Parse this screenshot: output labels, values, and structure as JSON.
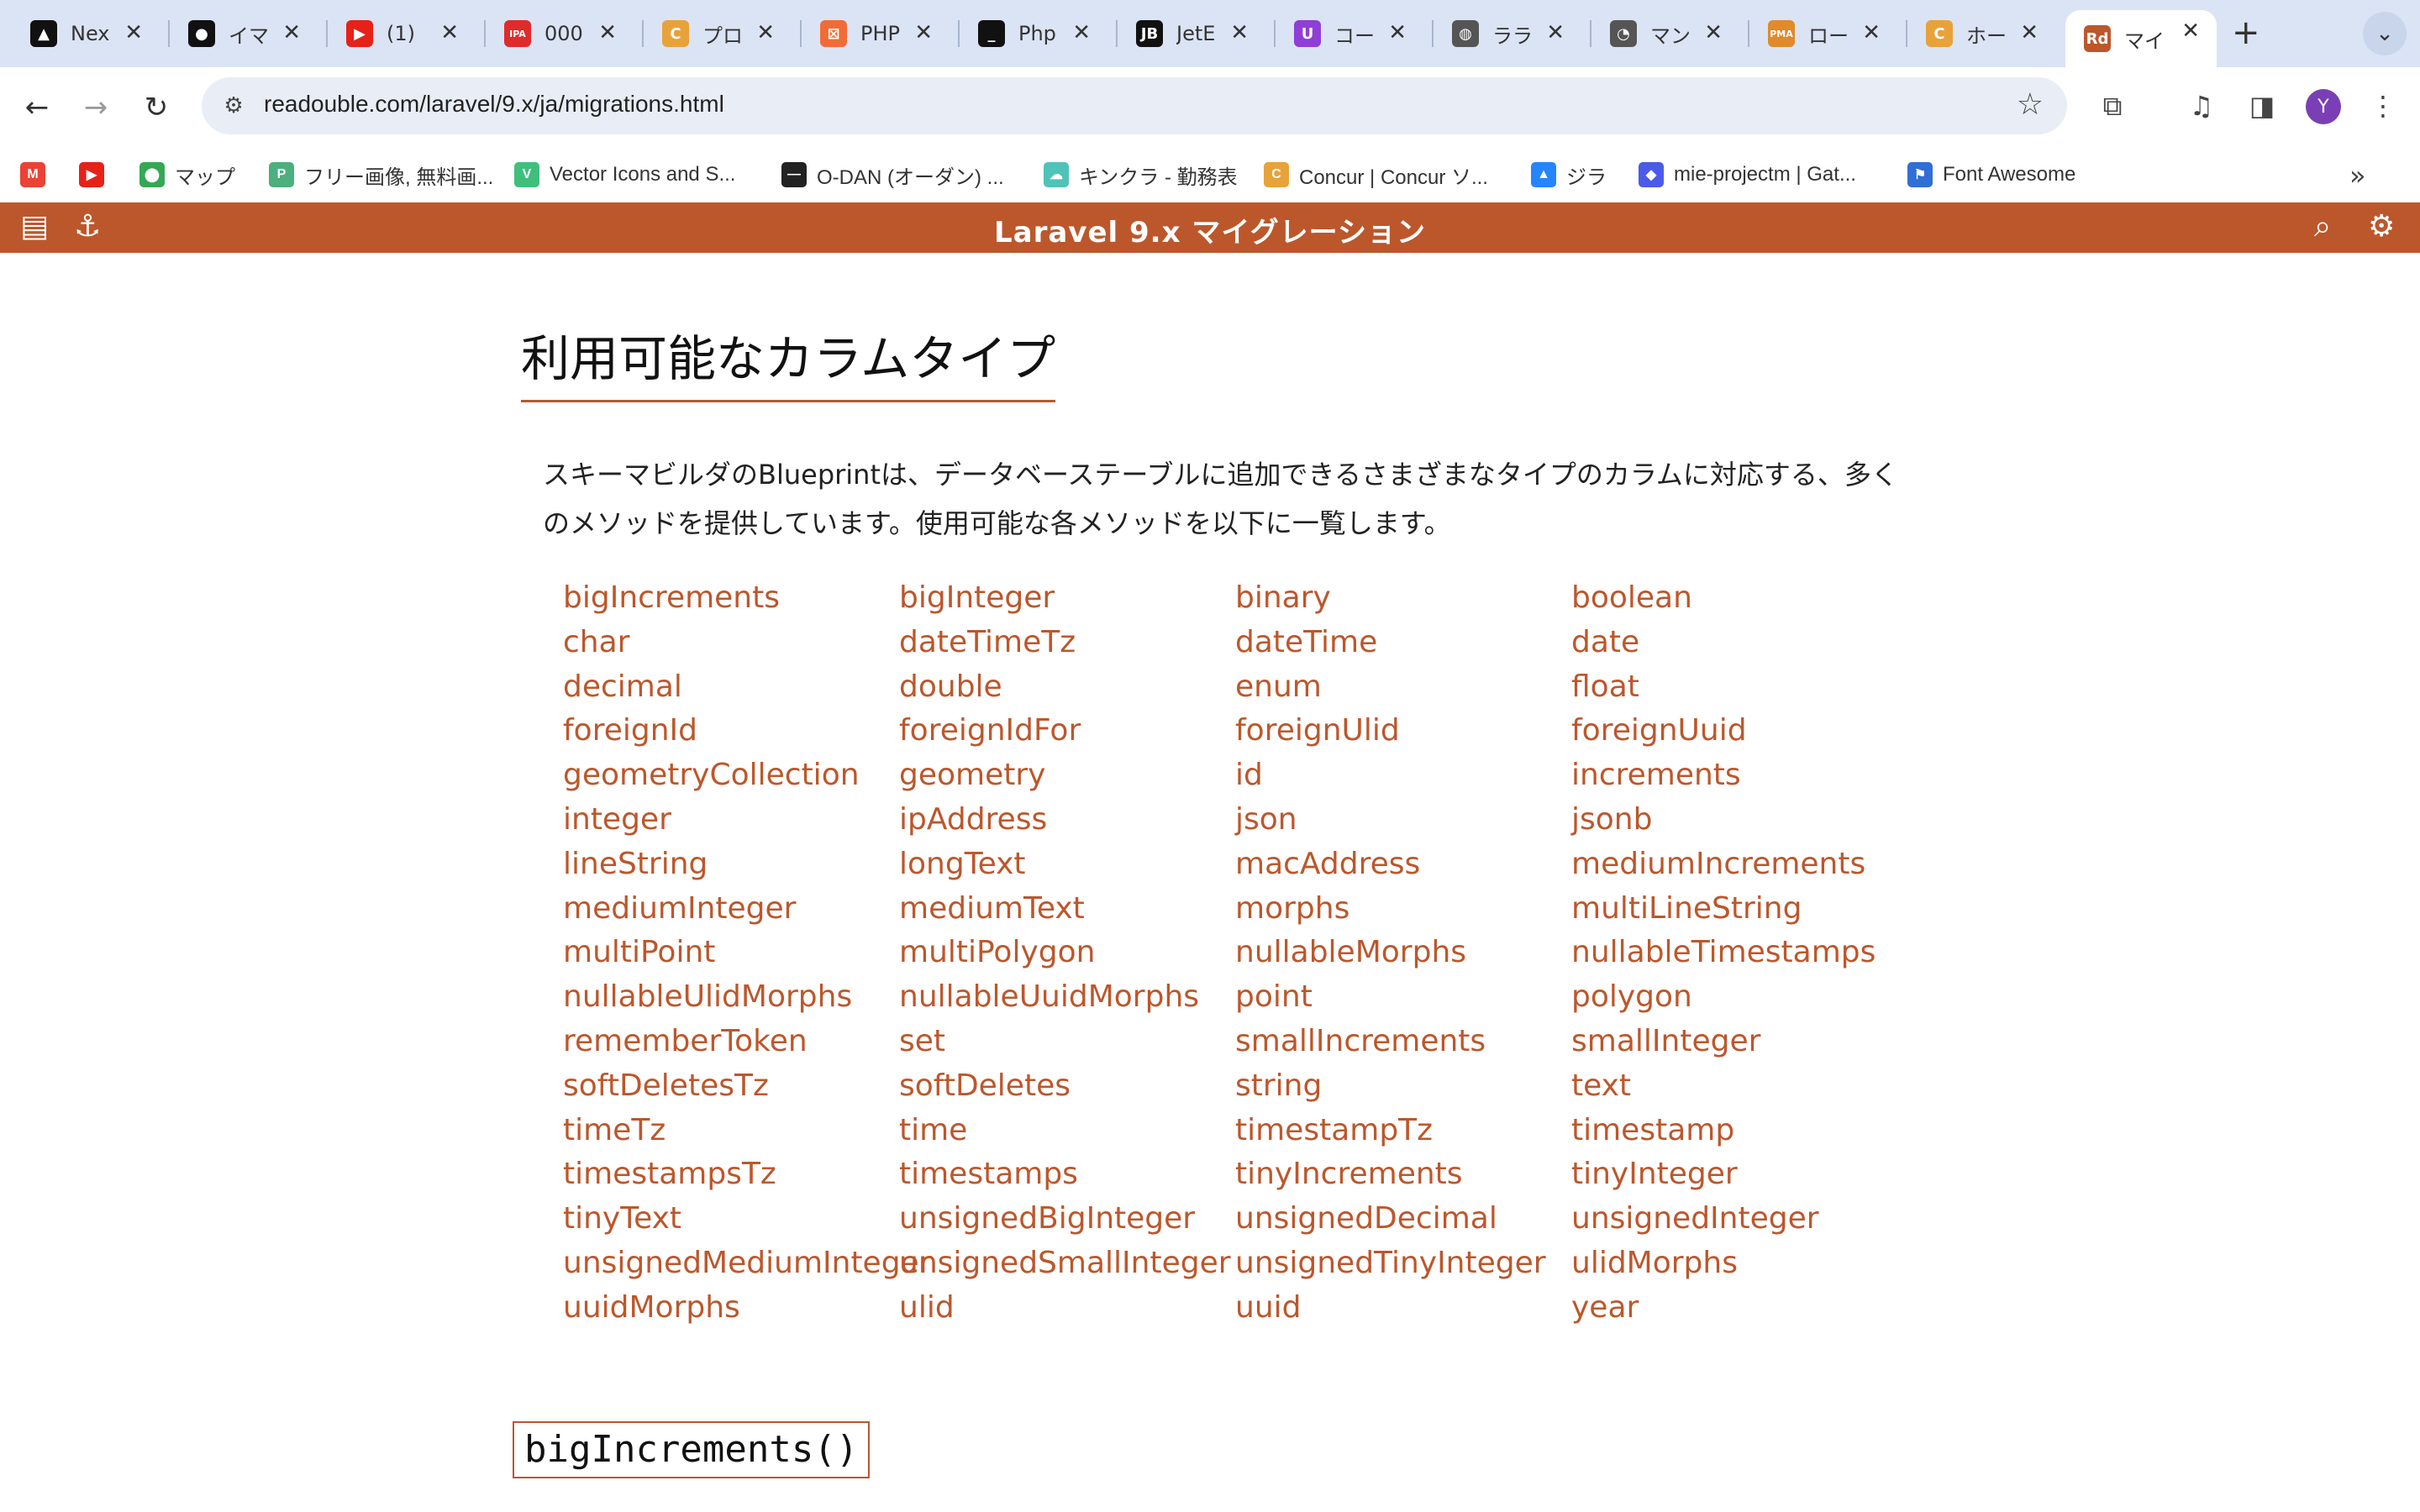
{
  "tabs": [
    {
      "title": "Nex",
      "icon": "next-icon",
      "color": "#111111",
      "glyph": "▲"
    },
    {
      "title": "イマ",
      "icon": "github-icon",
      "color": "#111111",
      "glyph": "●"
    },
    {
      "title": "(1)",
      "icon": "youtube-icon",
      "color": "#e62117",
      "glyph": "▶"
    },
    {
      "title": "000",
      "icon": "ipa-icon",
      "color": "#e02b2b",
      "glyph": "IPA"
    },
    {
      "title": "プロ",
      "icon": "course-icon",
      "color": "#e8a23a",
      "glyph": "C"
    },
    {
      "title": "PHP",
      "icon": "xampp-icon",
      "color": "#f26b36",
      "glyph": "⊠"
    },
    {
      "title": "Php",
      "icon": "terminal-icon",
      "color": "#111111",
      "glyph": "_"
    },
    {
      "title": "JetE",
      "icon": "jetbrains-icon",
      "color": "#111111",
      "glyph": "JB"
    },
    {
      "title": "コー",
      "icon": "udemy-icon",
      "color": "#8f3fd6",
      "glyph": "U"
    },
    {
      "title": "ララ",
      "icon": "globe-icon",
      "color": "#555555",
      "glyph": "◍"
    },
    {
      "title": "マン",
      "icon": "mantis-icon",
      "color": "#555555",
      "glyph": "◔"
    },
    {
      "title": "ロー",
      "icon": "phpmyadmin-icon",
      "color": "#e08a2b",
      "glyph": "PMA"
    },
    {
      "title": "ホー",
      "icon": "course-icon",
      "color": "#e8a23a",
      "glyph": "C"
    },
    {
      "title": "マイ",
      "icon": "readouble-icon",
      "color": "#bc572c",
      "glyph": "Rd",
      "active": true
    }
  ],
  "address_bar": {
    "url": "readouble.com/laravel/9.x/ja/migrations.html"
  },
  "bookmarks": [
    {
      "label": "",
      "icon": "gmail-icon",
      "color": "#ea4335",
      "glyph": "M"
    },
    {
      "label": "",
      "icon": "youtube-icon",
      "color": "#e62117",
      "glyph": "▶"
    },
    {
      "label": "マップ",
      "icon": "maps-icon",
      "color": "#34a853",
      "glyph": "⬤"
    },
    {
      "label": "フリー画像, 無料画...",
      "icon": "photo-icon",
      "color": "#4caf7d",
      "glyph": "P"
    },
    {
      "label": "Vector Icons and S...",
      "icon": "vector-icon",
      "color": "#3ec07c",
      "glyph": "V"
    },
    {
      "label": "O-DAN (オーダン) ...",
      "icon": "odan-icon",
      "color": "#222222",
      "glyph": "—"
    },
    {
      "label": "キンクラ - 勤務表",
      "icon": "kincla-icon",
      "color": "#4fc3b8",
      "glyph": "☁"
    },
    {
      "label": "Concur | Concur ソ...",
      "icon": "concur-icon",
      "color": "#e8a23a",
      "glyph": "C"
    },
    {
      "label": "ジラ",
      "icon": "jira-icon",
      "color": "#2684ff",
      "glyph": "▲"
    },
    {
      "label": "mie-projectm | Gat...",
      "icon": "gather-icon",
      "color": "#4b5be8",
      "glyph": "◆"
    },
    {
      "label": "Font Awesome",
      "icon": "flag-icon",
      "color": "#2f6fd6",
      "glyph": "⚑"
    }
  ],
  "header": {
    "title": "Laravel 9.x マイグレーション"
  },
  "content": {
    "heading": "利用可能なカラムタイプ",
    "intro": "スキーマビルダのBlueprintは、データベーステーブルに追加できるさまざまなタイプのカラムに対応する、多くのメソッドを提供しています。使用可能な各メソッドを以下に一覧します。",
    "column_types": [
      "bigIncrements",
      "bigInteger",
      "binary",
      "boolean",
      "char",
      "dateTimeTz",
      "dateTime",
      "date",
      "decimal",
      "double",
      "enum",
      "float",
      "foreignId",
      "foreignIdFor",
      "foreignUlid",
      "foreignUuid",
      "geometryCollection",
      "geometry",
      "id",
      "increments",
      "integer",
      "ipAddress",
      "json",
      "jsonb",
      "lineString",
      "longText",
      "macAddress",
      "mediumIncrements",
      "mediumInteger",
      "mediumText",
      "morphs",
      "multiLineString",
      "multiPoint",
      "multiPolygon",
      "nullableMorphs",
      "nullableTimestamps",
      "nullableUlidMorphs",
      "nullableUuidMorphs",
      "point",
      "polygon",
      "rememberToken",
      "set",
      "smallIncrements",
      "smallInteger",
      "softDeletesTz",
      "softDeletes",
      "string",
      "text",
      "timeTz",
      "time",
      "timestampTz",
      "timestamp",
      "timestampsTz",
      "timestamps",
      "tinyIncrements",
      "tinyInteger",
      "tinyText",
      "unsignedBigInteger",
      "unsignedDecimal",
      "unsignedInteger",
      "unsignedMediumInteger",
      "unsignedSmallInteger",
      "unsignedTinyInteger",
      "ulidMorphs",
      "uuidMorphs",
      "ulid",
      "uuid",
      "year"
    ],
    "method_heading": "bigIncrements()"
  },
  "colors": {
    "accent": "#bc572c",
    "tabbar": "#dbe4f4",
    "omnibox": "#e9eef6"
  }
}
